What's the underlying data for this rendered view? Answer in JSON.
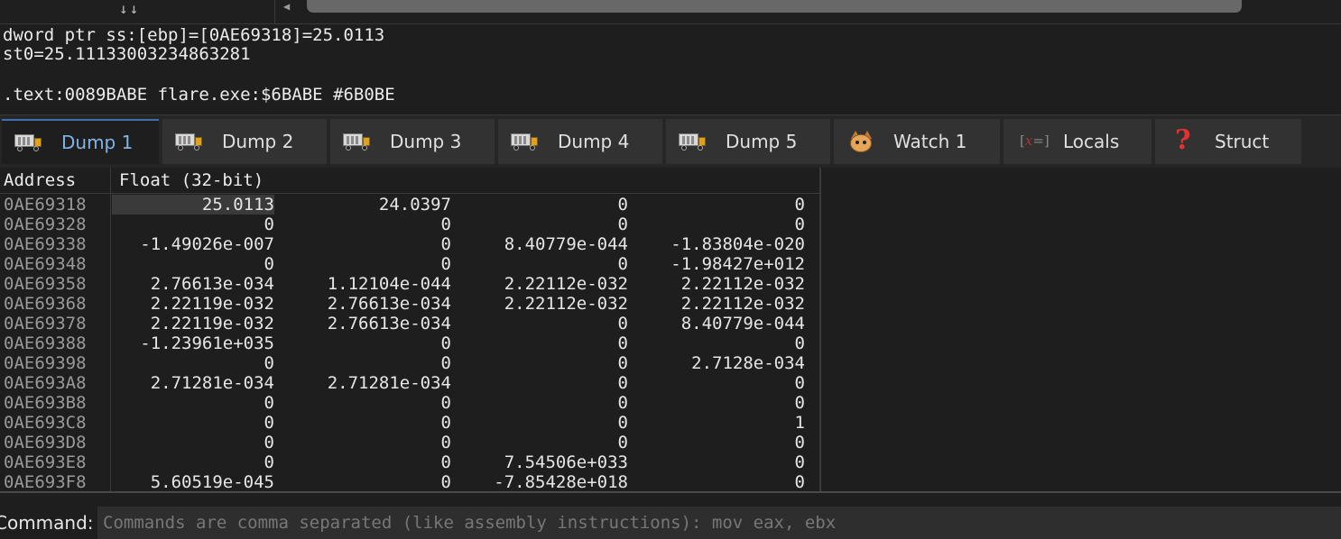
{
  "info": {
    "line1": "dword ptr ss:[ebp]=[0AE69318]=25.0113",
    "line2": "st0=25.11133003234863281",
    "line3": ".text:0089BABE flare.exe:$6BABE #6B0BE"
  },
  "tabs": [
    {
      "label": "Dump 1",
      "icon": "dump-truck-icon",
      "active": true
    },
    {
      "label": "Dump 2",
      "icon": "dump-truck-icon"
    },
    {
      "label": "Dump 3",
      "icon": "dump-truck-icon"
    },
    {
      "label": "Dump 4",
      "icon": "dump-truck-icon"
    },
    {
      "label": "Dump 5",
      "icon": "dump-truck-icon"
    },
    {
      "label": "Watch 1",
      "icon": "cat-icon"
    },
    {
      "label": "Locals",
      "icon": "x-equals-icon"
    },
    {
      "label": "Struct",
      "icon": "question-mark-icon"
    }
  ],
  "dump": {
    "header_address": "Address",
    "header_format": "Float (32-bit)",
    "rows": [
      {
        "addr": "0AE69318",
        "v": [
          "25.0113",
          "24.0397",
          "0",
          "0"
        ]
      },
      {
        "addr": "0AE69328",
        "v": [
          "0",
          "0",
          "0",
          "0"
        ]
      },
      {
        "addr": "0AE69338",
        "v": [
          "-1.49026e-007",
          "0",
          "8.40779e-044",
          "-1.83804e-020"
        ]
      },
      {
        "addr": "0AE69348",
        "v": [
          "0",
          "0",
          "0",
          "-1.98427e+012"
        ]
      },
      {
        "addr": "0AE69358",
        "v": [
          "2.76613e-034",
          "1.12104e-044",
          "2.22112e-032",
          "2.22112e-032"
        ]
      },
      {
        "addr": "0AE69368",
        "v": [
          "2.22119e-032",
          "2.76613e-034",
          "2.22112e-032",
          "2.22112e-032"
        ]
      },
      {
        "addr": "0AE69378",
        "v": [
          "2.22119e-032",
          "2.76613e-034",
          "0",
          "8.40779e-044"
        ]
      },
      {
        "addr": "0AE69388",
        "v": [
          "-1.23961e+035",
          "0",
          "0",
          "0"
        ]
      },
      {
        "addr": "0AE69398",
        "v": [
          "0",
          "0",
          "0",
          "2.7128e-034"
        ]
      },
      {
        "addr": "0AE693A8",
        "v": [
          "2.71281e-034",
          "2.71281e-034",
          "0",
          "0"
        ]
      },
      {
        "addr": "0AE693B8",
        "v": [
          "0",
          "0",
          "0",
          "0"
        ]
      },
      {
        "addr": "0AE693C8",
        "v": [
          "0",
          "0",
          "0",
          "1"
        ]
      },
      {
        "addr": "0AE693D8",
        "v": [
          "0",
          "0",
          "0",
          "0"
        ]
      },
      {
        "addr": "0AE693E8",
        "v": [
          "0",
          "0",
          "7.54506e+033",
          "0"
        ]
      },
      {
        "addr": "0AE693F8",
        "v": [
          "5.60519e-045",
          "0",
          "-7.85428e+018",
          "0"
        ]
      }
    ]
  },
  "command": {
    "label": "Command:",
    "placeholder": "Commands are comma separated (like assembly instructions): mov eax, ebx"
  },
  "colors": {
    "background": "#1e1e1e",
    "active_tab_text": "#7fb5e6",
    "address_text": "#9a9a9a"
  }
}
